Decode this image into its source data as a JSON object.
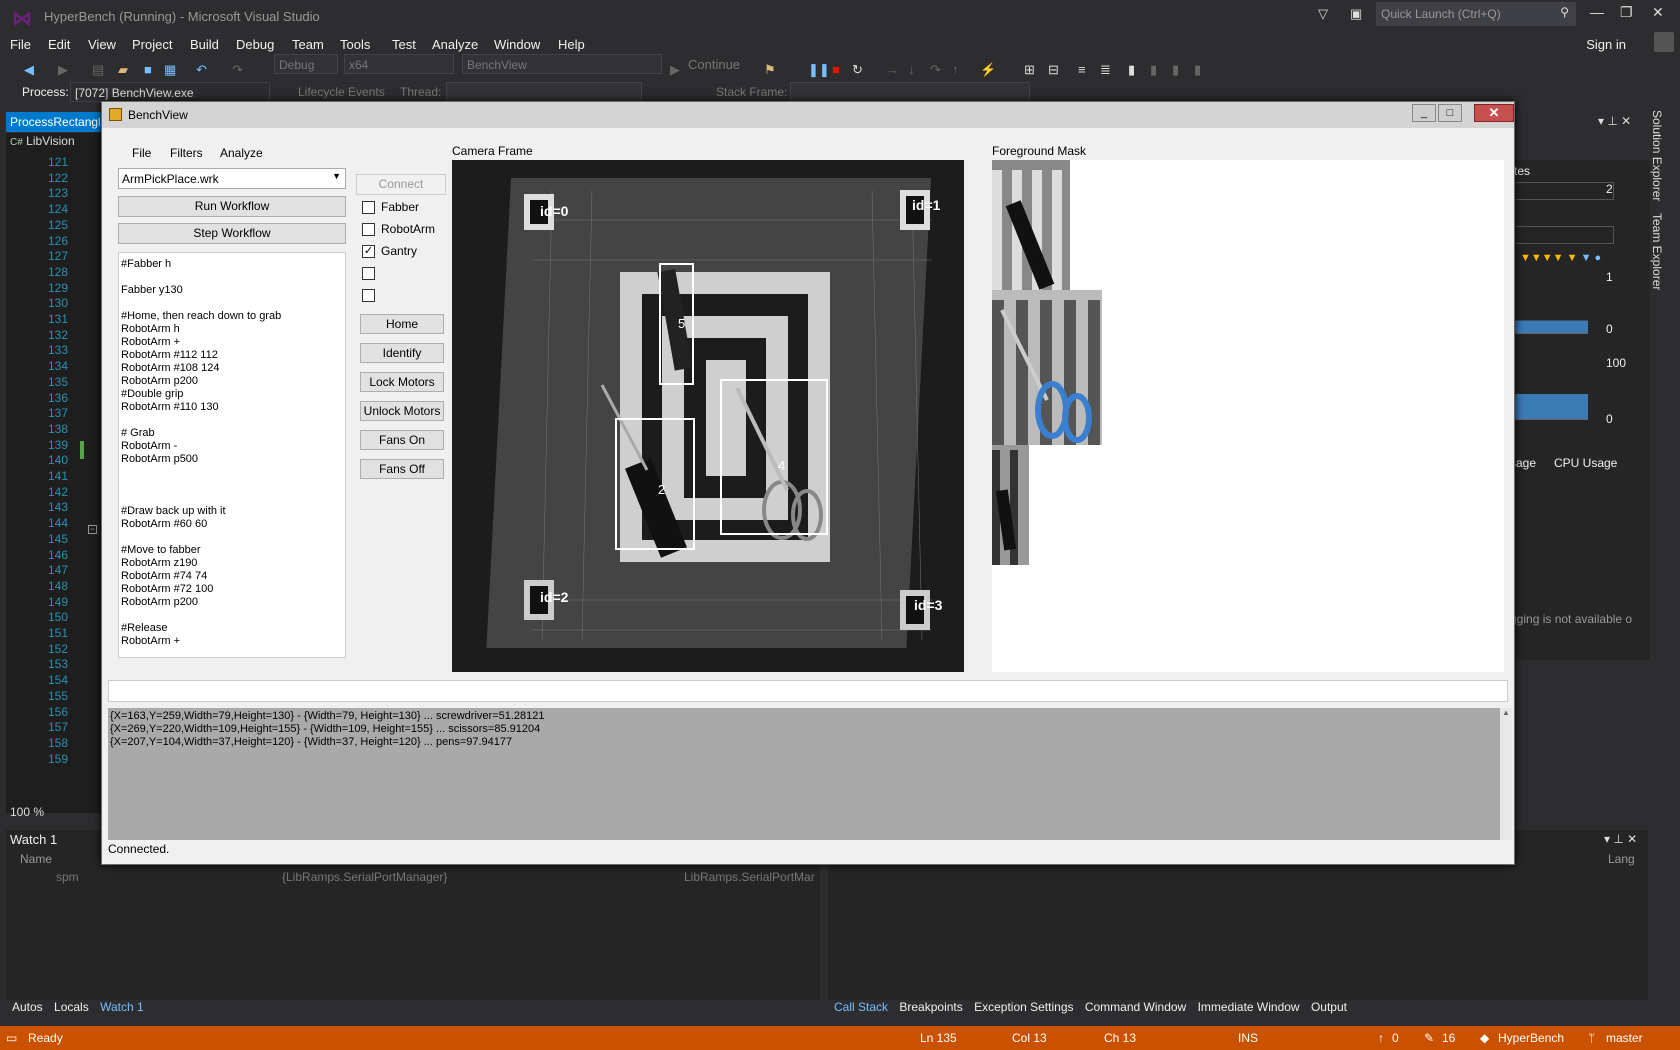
{
  "window": {
    "title": "HyperBench (Running) - Microsoft Visual Studio",
    "quick_launch": "Quick Launch (Ctrl+Q)",
    "signin": "Sign in"
  },
  "menu": [
    "File",
    "Edit",
    "View",
    "Project",
    "Build",
    "Debug",
    "Team",
    "Tools",
    "Test",
    "Analyze",
    "Window",
    "Help"
  ],
  "toolbar": {
    "config": "Debug",
    "platform": "x64",
    "startup": "BenchView",
    "continue": "Continue"
  },
  "process_bar": {
    "process_label": "Process:",
    "process": "[7072] BenchView.exe",
    "lifecycle": "Lifecycle Events",
    "thread_label": "Thread:",
    "stackframe_label": "Stack Frame:"
  },
  "editor": {
    "tab": "ProcessRectangle",
    "project": "LibVision",
    "lines": [
      "121",
      "122",
      "123",
      "124",
      "125",
      "126",
      "127",
      "128",
      "129",
      "130",
      "131",
      "132",
      "133",
      "134",
      "135",
      "136",
      "137",
      "138",
      "139",
      "140",
      "141",
      "142",
      "143",
      "144",
      "145",
      "146",
      "147",
      "148",
      "149",
      "150",
      "151",
      "152",
      "153",
      "154",
      "155",
      "156",
      "157",
      "158",
      "159"
    ],
    "zoom": "100 %"
  },
  "right_panel": {
    "cpu_usage": "CPU Usage",
    "usage_frag": "sage",
    "tes": "tes",
    "axis_1": "1",
    "axis_0a": "0",
    "axis_100": "100",
    "axis_0b": "0",
    "unavailable": "gging is not available o",
    "scroll_val": "2"
  },
  "side_tabs": [
    "Solution Explorer",
    "Team Explorer"
  ],
  "watch": {
    "title": "Watch 1",
    "col_name": "Name",
    "col_lang": "Lang",
    "row_name": "spm",
    "row_value": "{LibRamps.SerialPortManager}",
    "row_type": "LibRamps.SerialPortMar"
  },
  "bottom_tabs_left": [
    "Autos",
    "Locals",
    "Watch 1"
  ],
  "bottom_tabs_right": [
    "Call Stack",
    "Breakpoints",
    "Exception Settings",
    "Command Window",
    "Immediate Window",
    "Output"
  ],
  "status": {
    "ready": "Ready",
    "ln": "Ln 135",
    "col": "Col 13",
    "ch": "Ch 13",
    "ins": "INS",
    "up": "0",
    "edits": "16",
    "repo": "HyperBench",
    "branch": "master"
  },
  "benchview": {
    "title": "BenchView",
    "menu": [
      "File",
      "Filters",
      "Analyze"
    ],
    "workflow_file": "ArmPickPlace.wrk",
    "run_button": "Run Workflow",
    "step_button": "Step Workflow",
    "script": "#Fabber h\n\nFabber y130\n\n#Home, then reach down to grab\nRobotArm h\nRobotArm +\nRobotArm #112 112\nRobotArm #108 124\nRobotArm p200\n#Double grip\nRobotArm #110 130\n\n# Grab\nRobotArm -\nRobotArm p500\n\n\n\n#Draw back up with it\nRobotArm #60 60\n\n#Move to fabber\nRobotArm z190\nRobotArm #74 74\nRobotArm #72 100\nRobotArm p200\n\n#Release\nRobotArm +",
    "connect": "Connect",
    "checkboxes": [
      {
        "label": "Fabber",
        "checked": ""
      },
      {
        "label": "RobotArm",
        "checked": ""
      },
      {
        "label": "Gantry",
        "checked": "✓"
      },
      {
        "label": "",
        "checked": ""
      },
      {
        "label": "",
        "checked": ""
      }
    ],
    "buttons": [
      "Home",
      "Identify",
      "Lock Motors",
      "Unlock Motors",
      "Fans On",
      "Fans Off"
    ],
    "camera_label": "Camera Frame",
    "mask_label": "Foreground Mask",
    "markers": [
      "id=0",
      "id=1",
      "id=2",
      "id=3"
    ],
    "boxes": [
      "5",
      "2",
      "4"
    ],
    "log": "{X=163,Y=259,Width=79,Height=130} - {Width=79, Height=130} ... screwdriver=51.28121\n{X=269,Y=220,Width=109,Height=155} - {Width=109, Height=155} ... scissors=85.91204\n{X=207,Y=104,Width=37,Height=120} - {Width=37, Height=120} ... pens=97.94177",
    "status": "Connected."
  }
}
